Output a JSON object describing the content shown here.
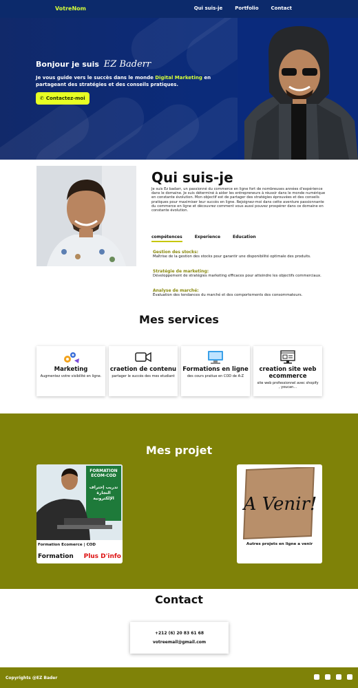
{
  "header": {
    "logo": "VotreNom",
    "nav": [
      "Qui suis-je",
      "Portfolio",
      "Contact"
    ]
  },
  "hero": {
    "greeting": "Bonjour je suis",
    "name": "EZ Baderr",
    "subtitle_before": "Je vous guide vers le succès dans le monde",
    "subtitle_highlight": "Digital Marketing",
    "subtitle_after": "en partageant des stratégies et des conseils pratiques.",
    "button": "Contactez-moi"
  },
  "about": {
    "title": "Qui suis-je",
    "text": "Je suis Ez badarr, un passionné du commerce en ligne fort de nombreuses années d'expérience dans le domaine. Je suis déterminé à aider les entrepreneurs à réussir dans le monde numérique en constante évolution. Mon objectif est de partager des stratégies éprouvées et des conseils pratiques pour maximiser leur succès en ligne. Rejoignez-moi dans cette aventure passionnante du commerce en ligne et découvrez comment vous aussi pouvez prospérer dans ce domaine en constante évolution.",
    "tabs": [
      "compétences",
      "Experience",
      "Education"
    ],
    "skills": [
      {
        "title": "Gestion des stocks:",
        "desc": "Maîtrise de la gestion des stocks pour garantir une disponibilité optimale des produits."
      },
      {
        "title": "Stratégie de marketing:",
        "desc": "Développement de stratégies marketing efficaces pour atteindre les objectifs commerciaux."
      },
      {
        "title": "Analyse de marché:",
        "desc": "Évaluation des tendances du marché et des comportements des consommateurs."
      }
    ]
  },
  "services": {
    "title": "Mes services",
    "items": [
      {
        "title": "Marketing",
        "desc": "Augmentez votre visibilité en ligne."
      },
      {
        "title": "craetion de contenu",
        "desc": "partager le succès des mes etudiant"
      },
      {
        "title": "Formations en ligne",
        "desc": "des cours pratiue en COD de A-Z"
      },
      {
        "title": "creation site web ecommerce",
        "desc": "site web professionnel avec shopify , youcan..."
      }
    ]
  },
  "projects": {
    "title": "Mes projet",
    "items": [
      {
        "caption": "Formation Ecomerce | COD",
        "tag": "Formation",
        "more": "Plus D'info",
        "banner": "FORMATION ECOM-COD",
        "banner_ar": "تدريب إحتراف التجارة الإلكترونية"
      },
      {
        "caption": "Autres projets en ligne a venir",
        "sign": "A Venir!"
      }
    ]
  },
  "contact": {
    "title": "Contact",
    "phone": "+212 (6) 20 83 61 68",
    "email": "votreemail@gmail.com"
  },
  "footer": {
    "copyright": "Copyrights @EZ Bader"
  },
  "colors": {
    "navy": "#0c2a6b",
    "lime": "#e7ff24",
    "olive": "#7f8208"
  }
}
